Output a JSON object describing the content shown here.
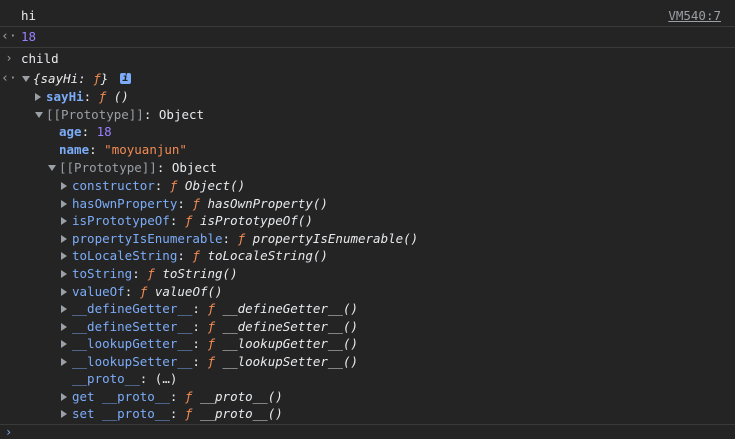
{
  "log_entry": {
    "message": "hi",
    "source": "VM540:7"
  },
  "result_entry": {
    "value": "18"
  },
  "input_entry": {
    "command": "child"
  },
  "object_preview": {
    "open": "{",
    "key": "sayHi",
    "colon": ":",
    "func": "ƒ",
    "close": "}",
    "badge": "i"
  },
  "tree": {
    "sayHi": {
      "key": "sayHi",
      "func": "ƒ",
      "sig": "()"
    },
    "proto1": {
      "label": "[[Prototype]]",
      "value": "Object"
    },
    "age": {
      "key": "age",
      "value": "18"
    },
    "name": {
      "key": "name",
      "value": "\"moyuanjun\""
    },
    "proto2": {
      "label": "[[Prototype]]",
      "value": "Object"
    },
    "methods": [
      {
        "key": "constructor",
        "sig": "Object()"
      },
      {
        "key": "hasOwnProperty",
        "sig": "hasOwnProperty()"
      },
      {
        "key": "isPrototypeOf",
        "sig": "isPrototypeOf()"
      },
      {
        "key": "propertyIsEnumerable",
        "sig": "propertyIsEnumerable()"
      },
      {
        "key": "toLocaleString",
        "sig": "toLocaleString()"
      },
      {
        "key": "toString",
        "sig": "toString()"
      },
      {
        "key": "valueOf",
        "sig": "valueOf()"
      },
      {
        "key": "__defineGetter__",
        "sig": "__defineGetter__()"
      },
      {
        "key": "__defineSetter__",
        "sig": "__defineSetter__()"
      },
      {
        "key": "__lookupGetter__",
        "sig": "__lookupGetter__()"
      },
      {
        "key": "__lookupSetter__",
        "sig": "__lookupSetter__()"
      }
    ],
    "proto_accessor": {
      "key": "__proto__",
      "value": "(…)"
    },
    "getter": {
      "prefix": "get",
      "key": "__proto__",
      "sig": "__proto__()"
    },
    "setter": {
      "prefix": "set",
      "key": "__proto__",
      "sig": "__proto__()"
    }
  },
  "colors": {
    "background": "#242424",
    "number": "#9980ff",
    "string": "#f28b54",
    "key": "#7cacf8"
  },
  "icons": {
    "result": "arrow-left-icon",
    "input": "chevron-right-icon",
    "expand": "triangle-down-icon",
    "collapse": "triangle-right-icon",
    "prompt": "prompt-caret-icon"
  }
}
